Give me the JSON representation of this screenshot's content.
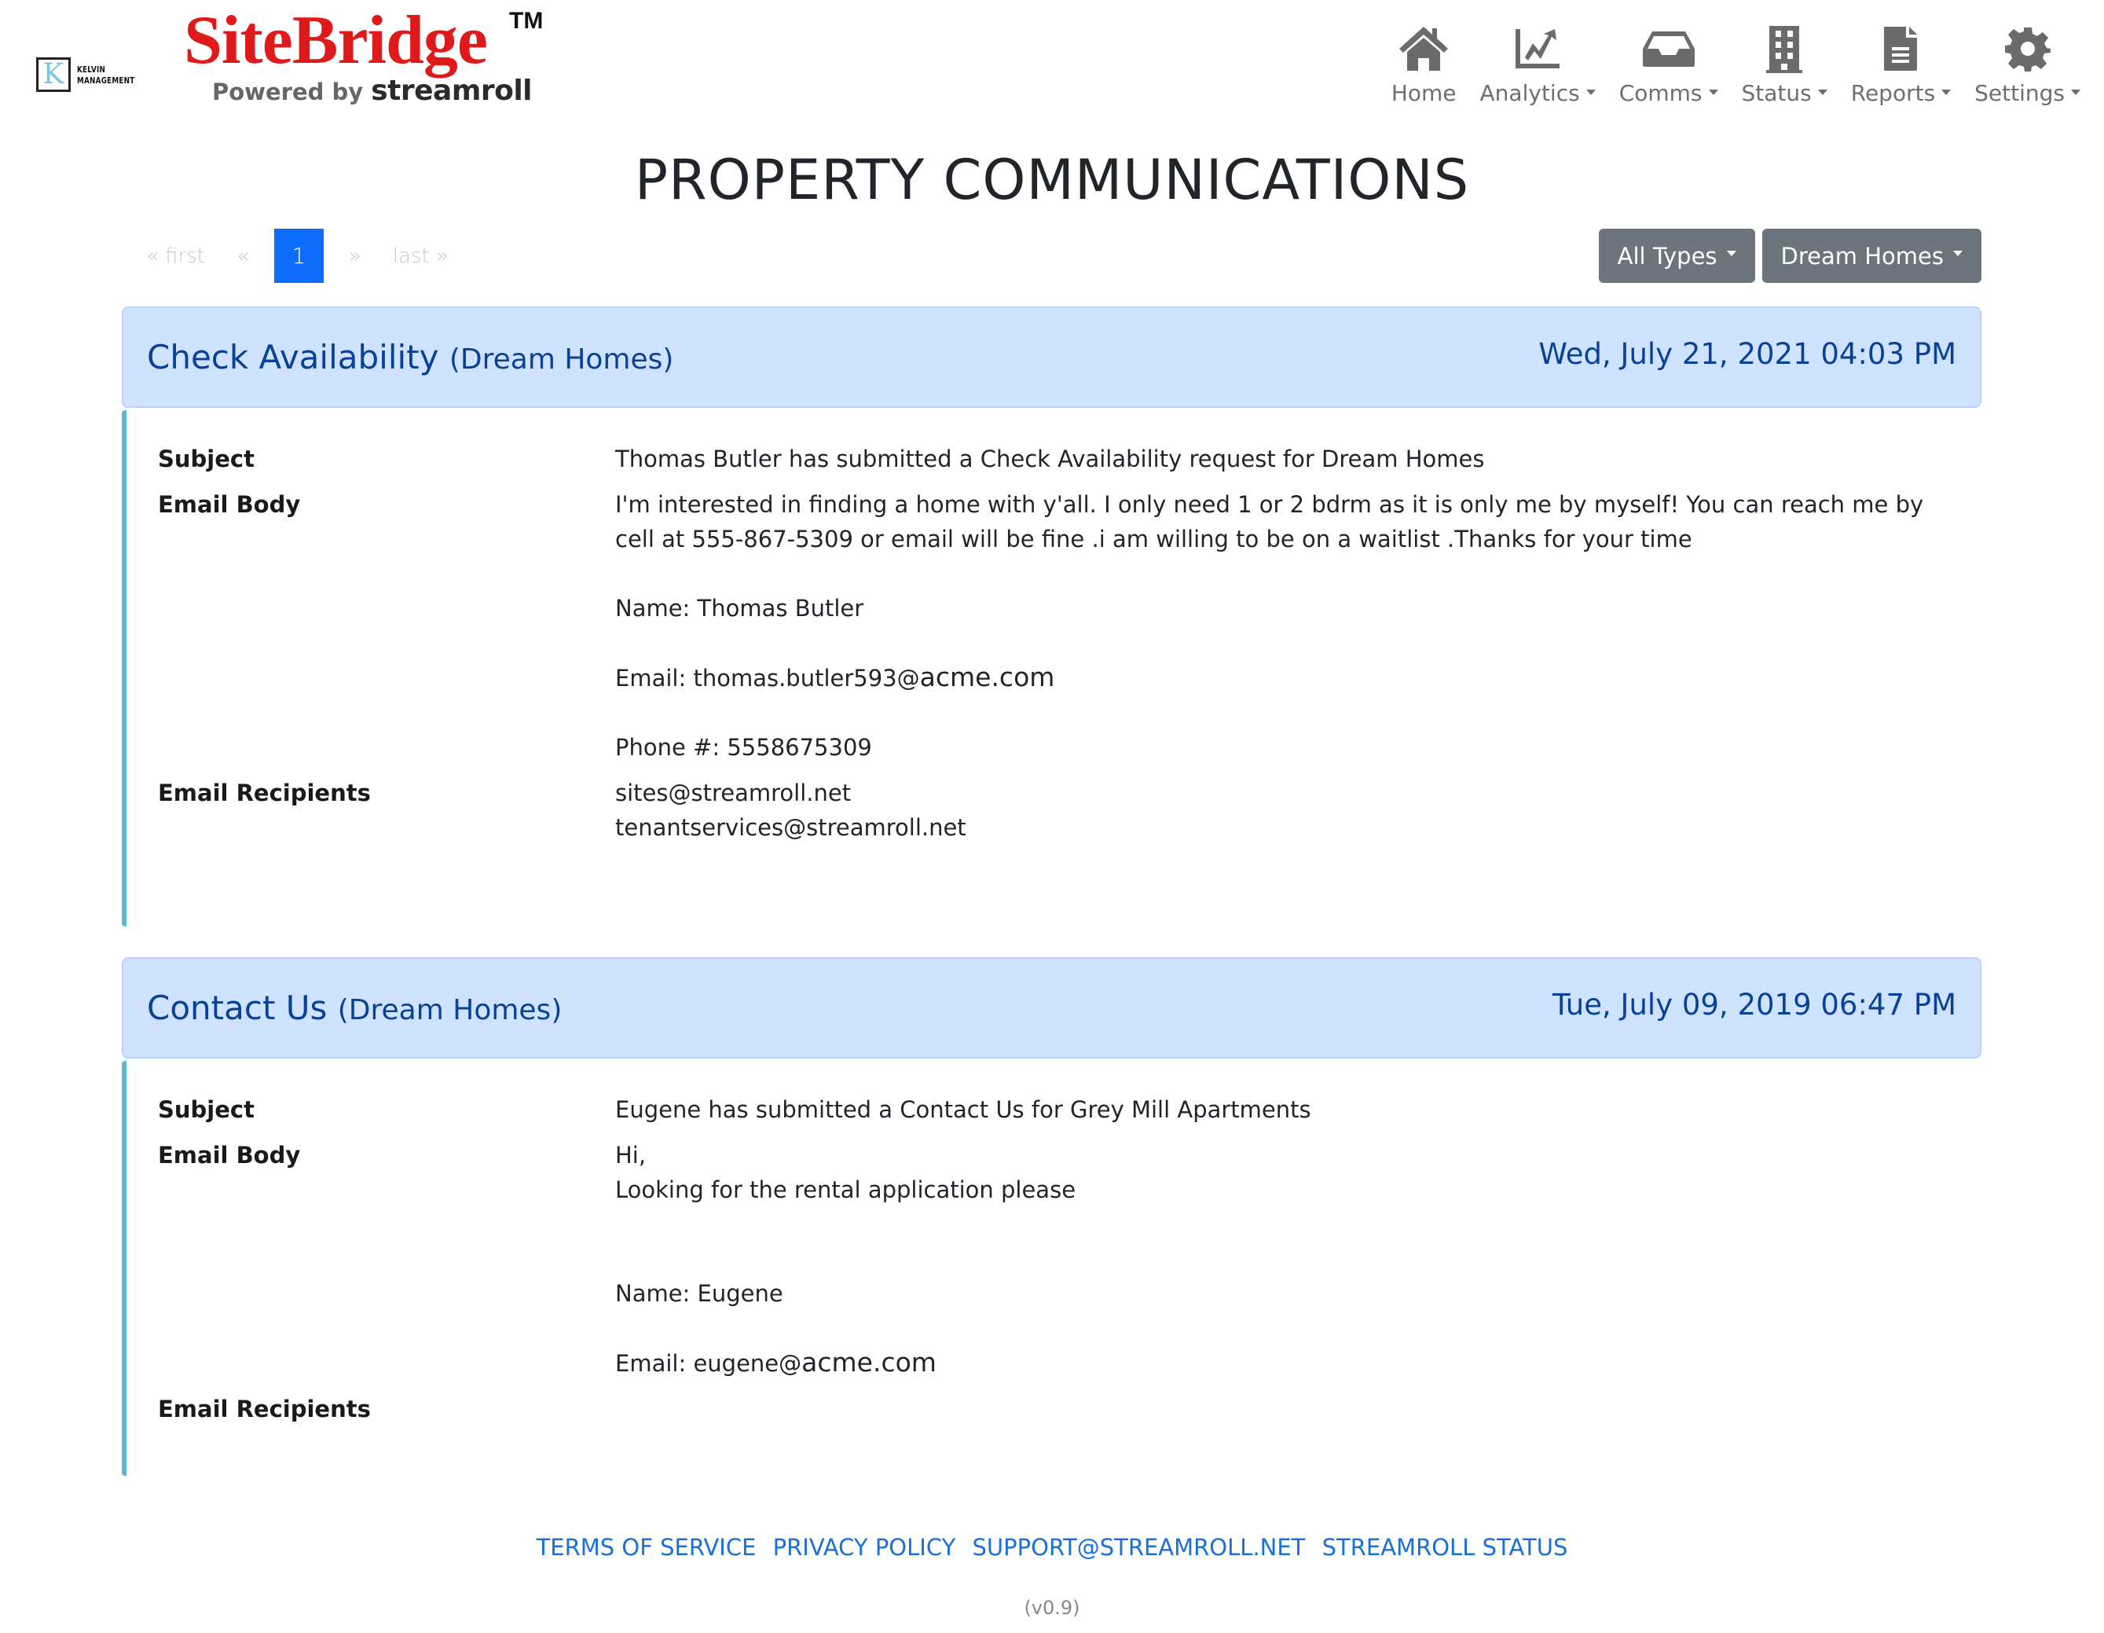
{
  "brand": {
    "company_initial": "K",
    "company_name_line1": "KELVIN",
    "company_name_line2": "MANAGEMENT",
    "product_name": "SiteBridge",
    "trademark": "TM",
    "powered_by": "Powered by",
    "powered_brand": "streamroll"
  },
  "nav": {
    "items": [
      {
        "label": "Home",
        "icon": "home-icon",
        "dropdown": false
      },
      {
        "label": "Analytics",
        "icon": "chart-line-icon",
        "dropdown": true
      },
      {
        "label": "Comms",
        "icon": "inbox-icon",
        "dropdown": true
      },
      {
        "label": "Status",
        "icon": "building-icon",
        "dropdown": true
      },
      {
        "label": "Reports",
        "icon": "file-text-icon",
        "dropdown": true
      },
      {
        "label": "Settings",
        "icon": "gear-icon",
        "dropdown": true
      }
    ]
  },
  "page": {
    "title": "PROPERTY COMMUNICATIONS"
  },
  "pagination": {
    "first": "« first",
    "prev": "«",
    "current": "1",
    "next": "»",
    "last": "last »"
  },
  "filters": {
    "type": "All Types",
    "property": "Dream Homes"
  },
  "communications": [
    {
      "type": "Check Availability",
      "property": "(Dream Homes)",
      "date": "Wed, July 21, 2021 04:03 PM",
      "labels": {
        "subject": "Subject",
        "body": "Email Body",
        "recipients": "Email Recipients"
      },
      "subject": "Thomas Butler has submitted a Check Availability request for Dream Homes",
      "body_message": "I'm interested in finding a home with y'all. I only need 1 or 2 bdrm as it is only me by myself! You can reach me by cell at 555-867-5309 or email will be fine .i am willing to be on a waitlist .Thanks for your time",
      "body_name": "Name: Thomas Butler",
      "body_email_prefix": "Email: thomas.butler593@",
      "body_email_domain": "acme.com",
      "body_phone": "Phone #: 5558675309",
      "recipients": [
        "sites@streamroll.net",
        "tenantservices@streamroll.net"
      ]
    },
    {
      "type": "Contact Us",
      "property": "(Dream Homes)",
      "date": "Tue, July 09, 2019 06:47 PM",
      "labels": {
        "subject": "Subject",
        "body": "Email Body",
        "recipients": "Email Recipients"
      },
      "subject": "Eugene has submitted a Contact Us for Grey Mill Apartments",
      "body_line1": "Hi,",
      "body_line2": "Looking for the rental application please",
      "body_name": "Name: Eugene",
      "body_email_prefix": "Email: eugene@",
      "body_email_domain": "acme.com",
      "recipients": []
    }
  ],
  "footer": {
    "links": [
      "TERMS OF SERVICE",
      "PRIVACY POLICY",
      "SUPPORT@STREAMROLL.NET",
      "STREAMROLL STATUS"
    ],
    "version": "(v0.9)"
  }
}
